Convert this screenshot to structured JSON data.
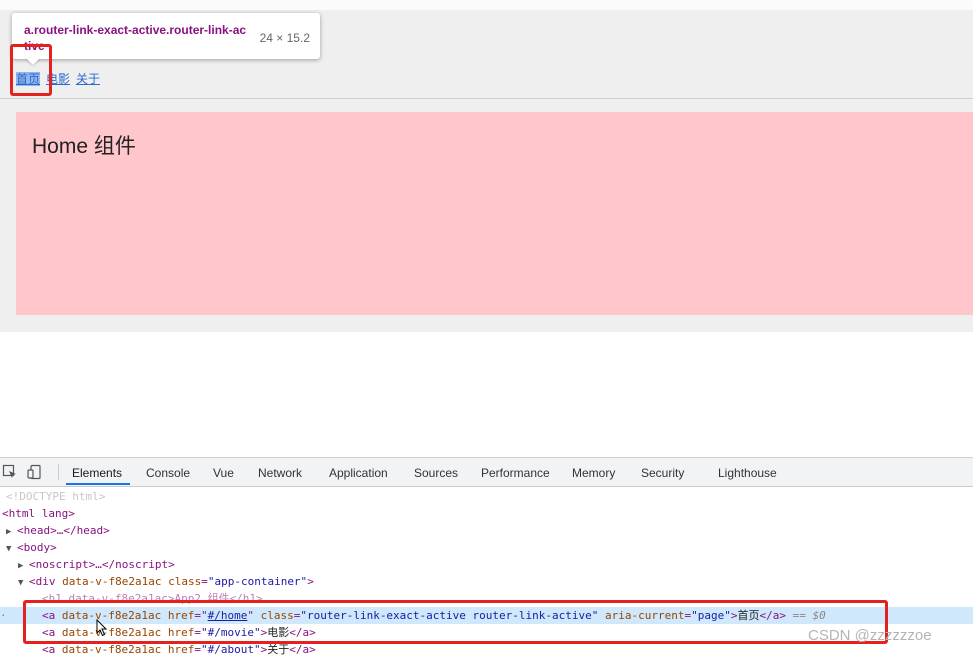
{
  "page": {
    "nav_links": [
      {
        "label": "首页",
        "active": true
      },
      {
        "label": "电影",
        "active": false
      },
      {
        "label": "关于",
        "active": false
      }
    ],
    "home_title": "Home 组件"
  },
  "tooltip": {
    "selector": "a.router-link-exact-active.router-link-active",
    "size": "24 × 15.2"
  },
  "devtools": {
    "tabs": [
      "Elements",
      "Console",
      "Vue",
      "Network",
      "Application",
      "Sources",
      "Performance",
      "Memory",
      "Security",
      "Lighthouse"
    ],
    "active_tab": "Elements",
    "dom": {
      "doctype": "<!DOCTYPE html>",
      "html_open": "<html lang>",
      "head": "<head>…</head>",
      "body_open": "<body>",
      "noscript": "<noscript>…</noscript>",
      "div_tag": "div",
      "div_attr1": "data-v-f8e2a1ac",
      "div_class_attr": "class",
      "div_class_val": "\"app-container\"",
      "h1_line": "<h1 data-v-f8e2a1ac>App2 组件</h1>",
      "sel_row": {
        "tag": "a",
        "attr1": "data-v-f8e2a1ac",
        "href_attr": "href",
        "href_val": "#/home",
        "class_attr": "class",
        "class_val": "\"router-link-exact-active router-link-active\"",
        "aria_attr": "aria-current",
        "aria_val": "\"page\"",
        "text": "首页",
        "close": "</a>",
        "suffix": "== $0"
      },
      "row2": {
        "tag": "a",
        "attr1": "data-v-f8e2a1ac",
        "href_attr": "href",
        "href_val": "\"#/movie\"",
        "text": "电影",
        "close": "</a>"
      },
      "row3": {
        "tag": "a",
        "attr1": "data-v-f8e2a1ac",
        "href_attr": "href",
        "href_val": "\"#/about\"",
        "text": "关于",
        "close": "</a>"
      }
    }
  },
  "watermark": "CSDN @zzzzzzoe",
  "colors": {
    "highlight_red": "#e3211e",
    "home_bg": "#ffc6cc",
    "selected_row": "#cfe8fc"
  }
}
